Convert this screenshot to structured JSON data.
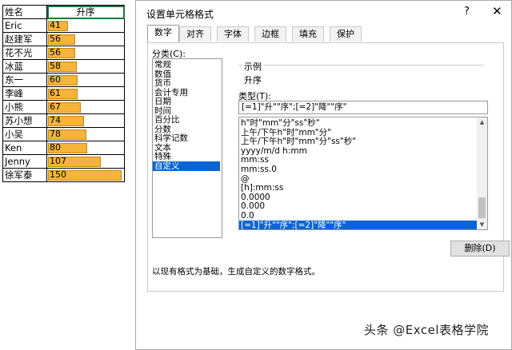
{
  "sheet": {
    "header_name": "姓名",
    "header_value": "升序",
    "max_value": 150,
    "bar_color": "#f6b53a",
    "rows": [
      {
        "name": "Eric",
        "value": 41
      },
      {
        "name": "赵建军",
        "value": 56
      },
      {
        "name": "花不光",
        "value": 56
      },
      {
        "name": "冰蓝",
        "value": 58
      },
      {
        "name": "东一",
        "value": 60
      },
      {
        "name": "李峰",
        "value": 61
      },
      {
        "name": "小熊",
        "value": 67
      },
      {
        "name": "苏小想",
        "value": 74
      },
      {
        "name": "小吴",
        "value": 78
      },
      {
        "name": "Ken",
        "value": 80
      },
      {
        "name": "Jenny",
        "value": 107
      },
      {
        "name": "徐军泰",
        "value": 150
      }
    ]
  },
  "dialog": {
    "title": "设置单元格格式",
    "help_icon": "?",
    "close_icon": "✕",
    "tabs": [
      "数字",
      "对齐",
      "字体",
      "边框",
      "填充",
      "保护"
    ],
    "active_tab": 0,
    "category_label": "分类(C):",
    "categories": [
      "常规",
      "数值",
      "货币",
      "会计专用",
      "日期",
      "时间",
      "百分比",
      "分数",
      "科学记数",
      "文本",
      "特殊",
      "自定义"
    ],
    "selected_category": 11,
    "sample_label": "示例",
    "sample_value": "升序",
    "type_label": "类型(T):",
    "type_value": "[=1]\"升\"\"序\";[=2]\"降\"\"序\"",
    "formats": [
      "h\"时\"mm\"分\"ss\"秒\"",
      "上午/下午h\"时\"mm\"分\"",
      "上午/下午h\"时\"mm\"分\"ss\"秒\"",
      "yyyy/m/d h:mm",
      "mm:ss",
      "mm:ss.0",
      "@",
      "[h]:mm:ss",
      "0.0000",
      "0.000",
      "0.0",
      "[=1]\"升\"\"序\";[=2]\"降\"\"序\""
    ],
    "selected_format": 11,
    "delete_button": "删除(D)",
    "description": "以现有格式为基础，生成自定义的数字格式。"
  },
  "watermark": "头条 @Excel表格学院"
}
